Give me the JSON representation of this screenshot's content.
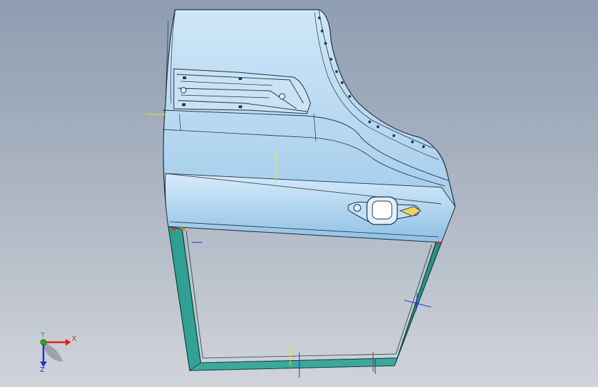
{
  "viewport": {
    "background_top": "#8e9db1",
    "background_bottom": "#d1d4da"
  },
  "model": {
    "name": "car-door-panel",
    "panel_color": "#bcdcf2",
    "panel_shade": "#8fbfe2",
    "frame_color": "#2fa89a",
    "frame_edge": "#0e3e38",
    "handle_latch_color": "#f0d060"
  },
  "triad": {
    "x_label": "X",
    "y_label": "Y",
    "z_label": "Z",
    "x_color": "#e02020",
    "y_color": "#20b020",
    "z_color": "#2030d0"
  }
}
